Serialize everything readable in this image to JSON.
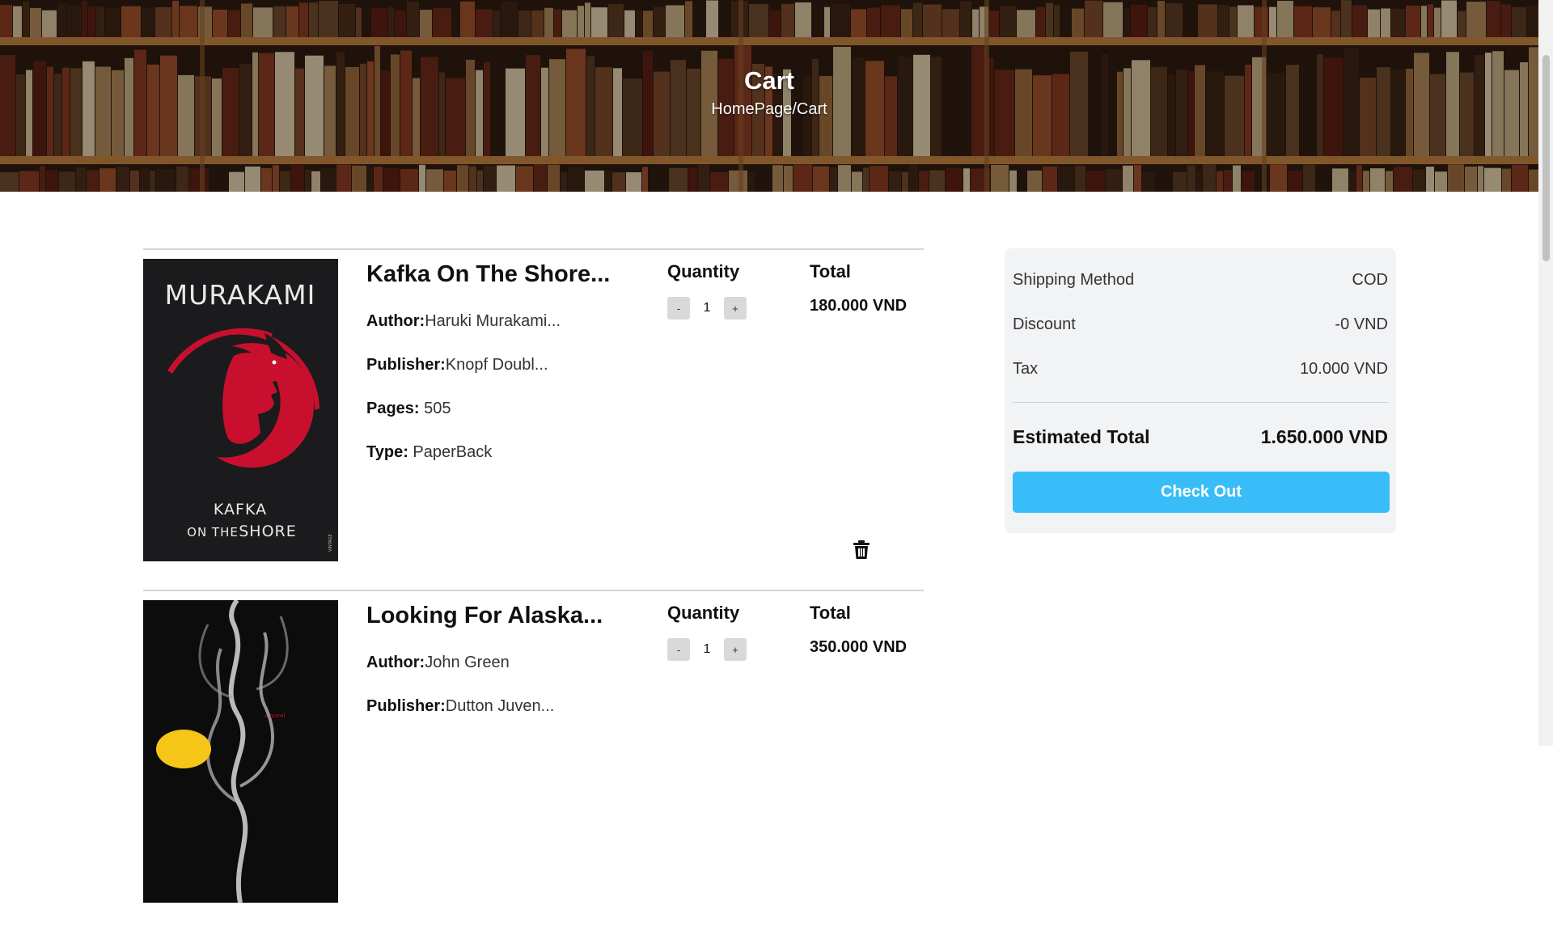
{
  "hero": {
    "title": "Cart",
    "breadcrumb": "HomePage/Cart"
  },
  "columns": {
    "quantity": "Quantity",
    "total": "Total"
  },
  "labels": {
    "author": "Author:",
    "publisher": "Publisher:",
    "pages": "Pages:",
    "type": "Type:"
  },
  "stepper": {
    "minus": "-",
    "plus": "+"
  },
  "items": [
    {
      "title": "Kafka On The Shore...",
      "author": "Haruki Murakami...",
      "publisher": "Knopf Doubl...",
      "pages": "505",
      "type": "PaperBack",
      "quantity": "1",
      "total": "180.000 VND",
      "cover": {
        "author": "MURAKAMI",
        "title_line1": "KAFKA",
        "title_line2_prefix": "ON THE",
        "title_line2_main": "SHORE",
        "spine": "VINTAGE"
      }
    },
    {
      "title": "Looking For Alaska...",
      "author": "John Green",
      "publisher": "Dutton Juven...",
      "quantity": "1",
      "total": "350.000 VND",
      "cover": {
        "tag": "a novel"
      }
    }
  ],
  "summary": {
    "shipping_label": "Shipping Method",
    "shipping_value": "COD",
    "discount_label": "Discount",
    "discount_value": "-0 VND",
    "tax_label": "Tax",
    "tax_value": "10.000 VND",
    "estimated_label": "Estimated Total",
    "estimated_value": "1.650.000 VND",
    "checkout_label": "Check Out"
  },
  "colors": {
    "accent": "#38bdf8",
    "cover_red": "#c8102e",
    "cover_dark": "#1b1b1d"
  },
  "icons": {
    "delete": "trash-icon"
  }
}
